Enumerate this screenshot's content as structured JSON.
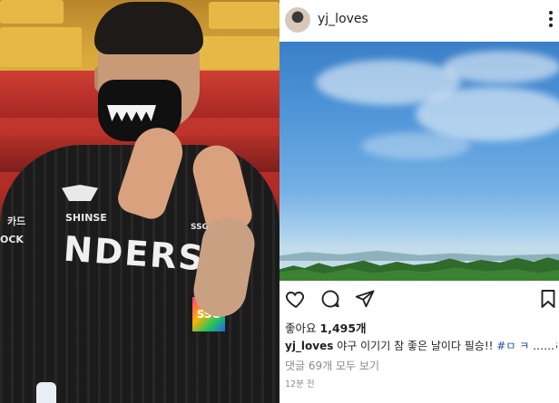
{
  "left_photo": {
    "jersey_wordmark": "NDERS",
    "sponsor_left": "SHINSE",
    "sponsor_patch_1": "카드",
    "sponsor_patch_2": "OCK",
    "badge": "SSG",
    "badge_small": "SSG"
  },
  "post": {
    "username": "yj_loves",
    "likes_label": "좋아요",
    "likes_count": "1,495개",
    "caption_user": "yj_loves",
    "caption_text": "야구 이기기 참 좋은 날이다 필승!!",
    "caption_tag": "#ㅁ ㅋ",
    "caption_more": "……ㄹ",
    "comments_link": "댓글 69개 모두 보기",
    "time_ago": "12분 전"
  },
  "icons": {
    "like": "heart-icon",
    "comment": "comment-icon",
    "share": "send-icon",
    "save": "bookmark-icon",
    "more": "more-vertical-icon"
  },
  "colors": {
    "hashtag": "#1a56a0",
    "muted_text": "#8a8a8a",
    "sky_top": "#3b7fc8",
    "tree_green": "#2f6b2a"
  }
}
